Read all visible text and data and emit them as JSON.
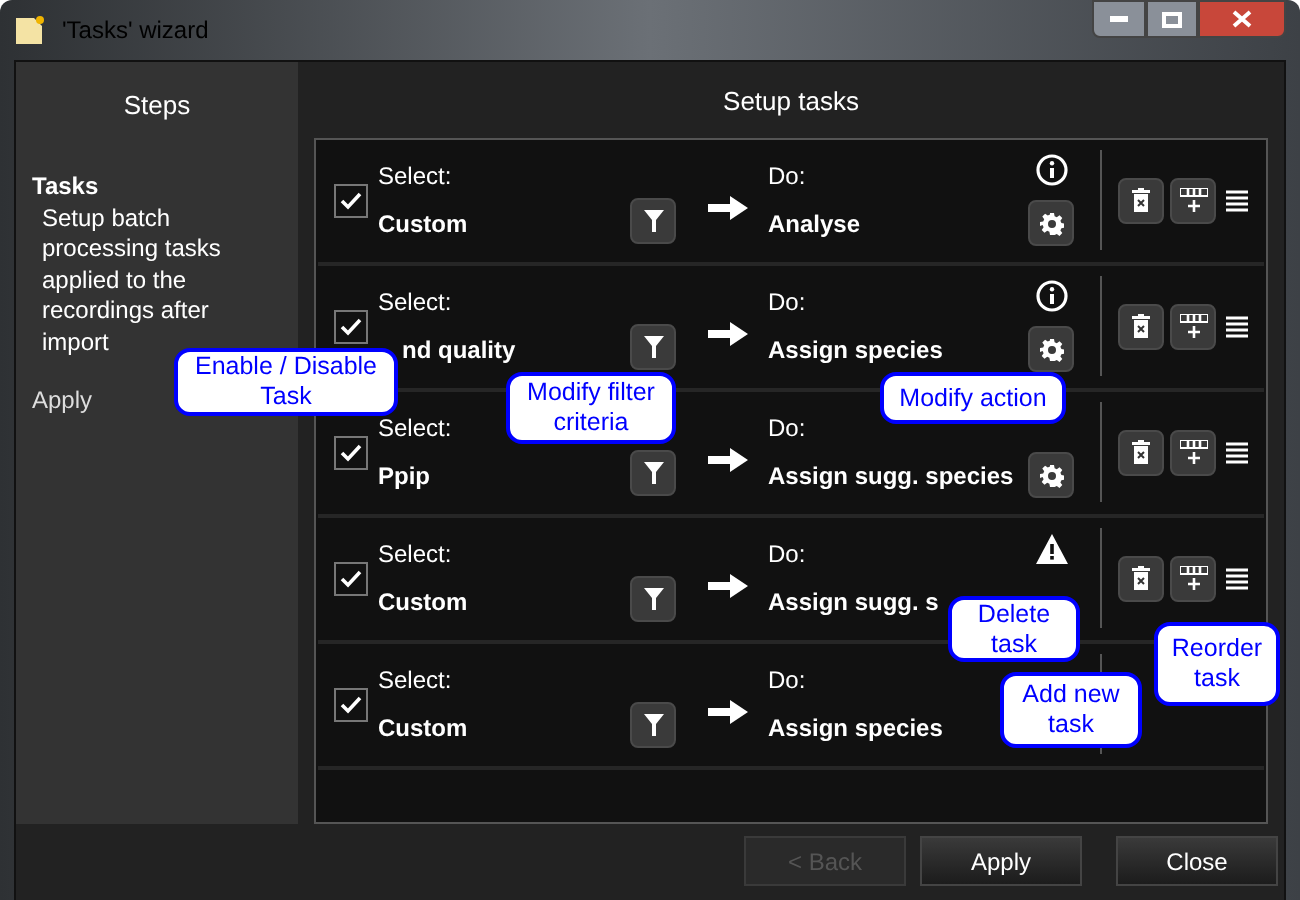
{
  "window": {
    "title": "'Tasks' wizard"
  },
  "steps": {
    "title": "Steps",
    "items": [
      {
        "label": "Tasks",
        "selected": true,
        "description": "Setup batch processing tasks applied to the recordings after import"
      },
      {
        "label": "Apply",
        "selected": false
      }
    ]
  },
  "main": {
    "title": "Setup tasks"
  },
  "tasks": [
    {
      "enabled": true,
      "select_label": "Select:",
      "select_value": "Custom",
      "do_label": "Do:",
      "do_value": "Analyse",
      "info_icon": true,
      "warning_icon": false,
      "gear": true,
      "controls": true
    },
    {
      "enabled": true,
      "select_label": "Select:",
      "select_value": "nd quality",
      "do_label": "Do:",
      "do_value": "Assign species",
      "info_icon": true,
      "warning_icon": false,
      "gear": true,
      "controls": true
    },
    {
      "enabled": true,
      "select_label": "Select:",
      "select_value": "Ppip",
      "do_label": "Do:",
      "do_value": "Assign sugg. species",
      "info_icon": false,
      "warning_icon": false,
      "gear": true,
      "controls": true
    },
    {
      "enabled": true,
      "select_label": "Select:",
      "select_value": "Custom",
      "do_label": "Do:",
      "do_value": "Assign sugg. s",
      "info_icon": false,
      "warning_icon": true,
      "gear": false,
      "controls": true
    },
    {
      "enabled": true,
      "select_label": "Select:",
      "select_value": "Custom",
      "do_label": "Do:",
      "do_value": "Assign species",
      "info_icon": false,
      "warning_icon": false,
      "gear": false,
      "controls": false
    }
  ],
  "callouts": [
    {
      "text": "Enable / Disable Task"
    },
    {
      "text": "Modify filter criteria"
    },
    {
      "text": "Modify action"
    },
    {
      "text": "Delete task"
    },
    {
      "text": "Add new task"
    },
    {
      "text": "Reorder task"
    }
  ],
  "buttons": [
    {
      "label": "< Back",
      "disabled": true
    },
    {
      "label": "Apply",
      "disabled": false
    },
    {
      "label": "Close",
      "disabled": false
    }
  ]
}
